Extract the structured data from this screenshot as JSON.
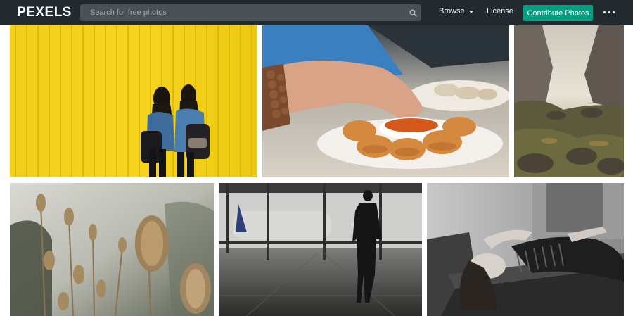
{
  "header": {
    "logo": "PEXELS",
    "search_placeholder": "Search for free photos",
    "browse_label": "Browse",
    "license_label": "License",
    "contribute_label": "Contribute Photos"
  },
  "colors": {
    "nav_background": "#232a2f",
    "search_background": "#4a5055",
    "accent_green": "#05a081"
  },
  "icons": {
    "search": "search-icon",
    "browse_caret": "caret-down-icon",
    "more": "more-dots-icon"
  },
  "photos": [
    {
      "subject": "yellow-wall-two-women-backpacks"
    },
    {
      "subject": "dumplings-sauce-hand"
    },
    {
      "subject": "mountain-canyon-mist"
    },
    {
      "subject": "teasel-plants"
    },
    {
      "subject": "airport-silhouette-window"
    },
    {
      "subject": "woman-lying-on-bench-bw"
    }
  ]
}
